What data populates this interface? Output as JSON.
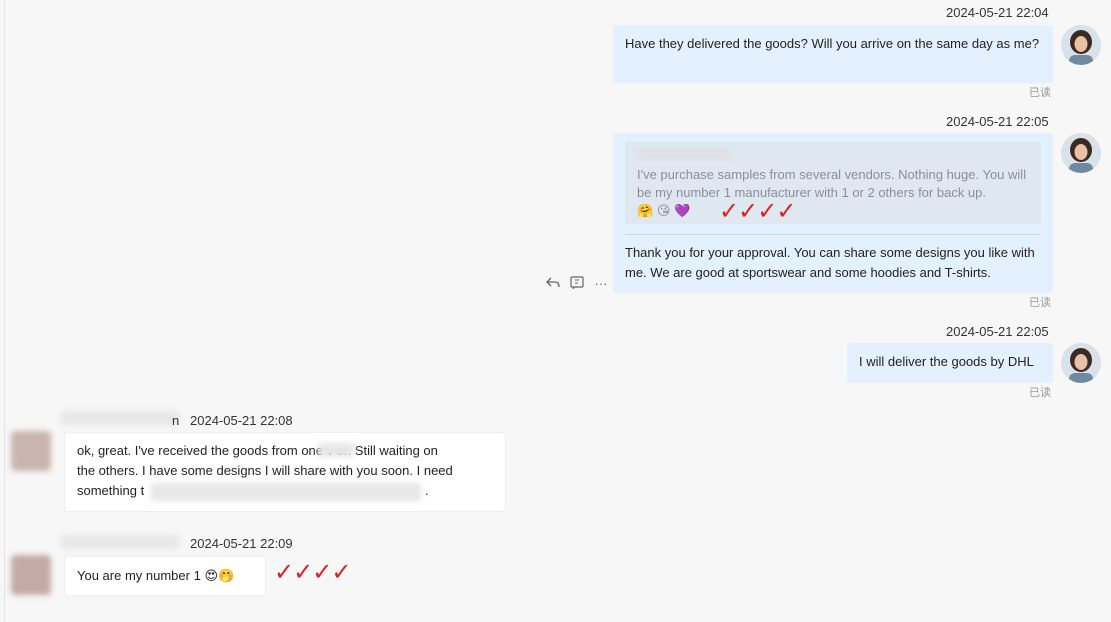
{
  "messages": [
    {
      "side": "right",
      "timestamp": "2024-05-21 22:04",
      "text": "Have they delivered the goods? Will you arrive on the same day as me?",
      "read_label": "已读"
    },
    {
      "side": "right",
      "timestamp": "2024-05-21 22:05",
      "quoted_text": "I've purchase samples from several vendors. Nothing huge. You will be my number 1 manufacturer with 1 or 2 others for back up.",
      "quoted_emojis": [
        "🤗",
        "😘",
        "💜"
      ],
      "text": "Thank you for your approval. You can share some designs you like with me. We are good at sportswear and some hoodies and T-shirts.",
      "read_label": "已读",
      "annotation_checks": "✓✓✓✓"
    },
    {
      "side": "right",
      "timestamp": "2024-05-21 22:05",
      "text": "I will deliver the goods by DHL",
      "read_label": "已读"
    },
    {
      "side": "left",
      "sender_suffix": "n",
      "timestamp": "2024-05-21 22:08",
      "text_lines": [
        "ok, great. I've received the goods from one v     or. Still waiting on",
        "the others. I have some designs I will share with you soon. I need",
        "something t"
      ],
      "trailing": "."
    },
    {
      "side": "left",
      "sender_suffix": "",
      "timestamp": "2024-05-21 22:09",
      "text": "You are my number 1",
      "emojis": [
        "😍",
        "🤭"
      ],
      "annotation_checks": "✓✓✓✓"
    }
  ],
  "toolbar": {
    "reply_icon": "reply-icon",
    "quote_icon": "quote-icon",
    "more_icon": "more-icon",
    "more_glyph": "···"
  }
}
